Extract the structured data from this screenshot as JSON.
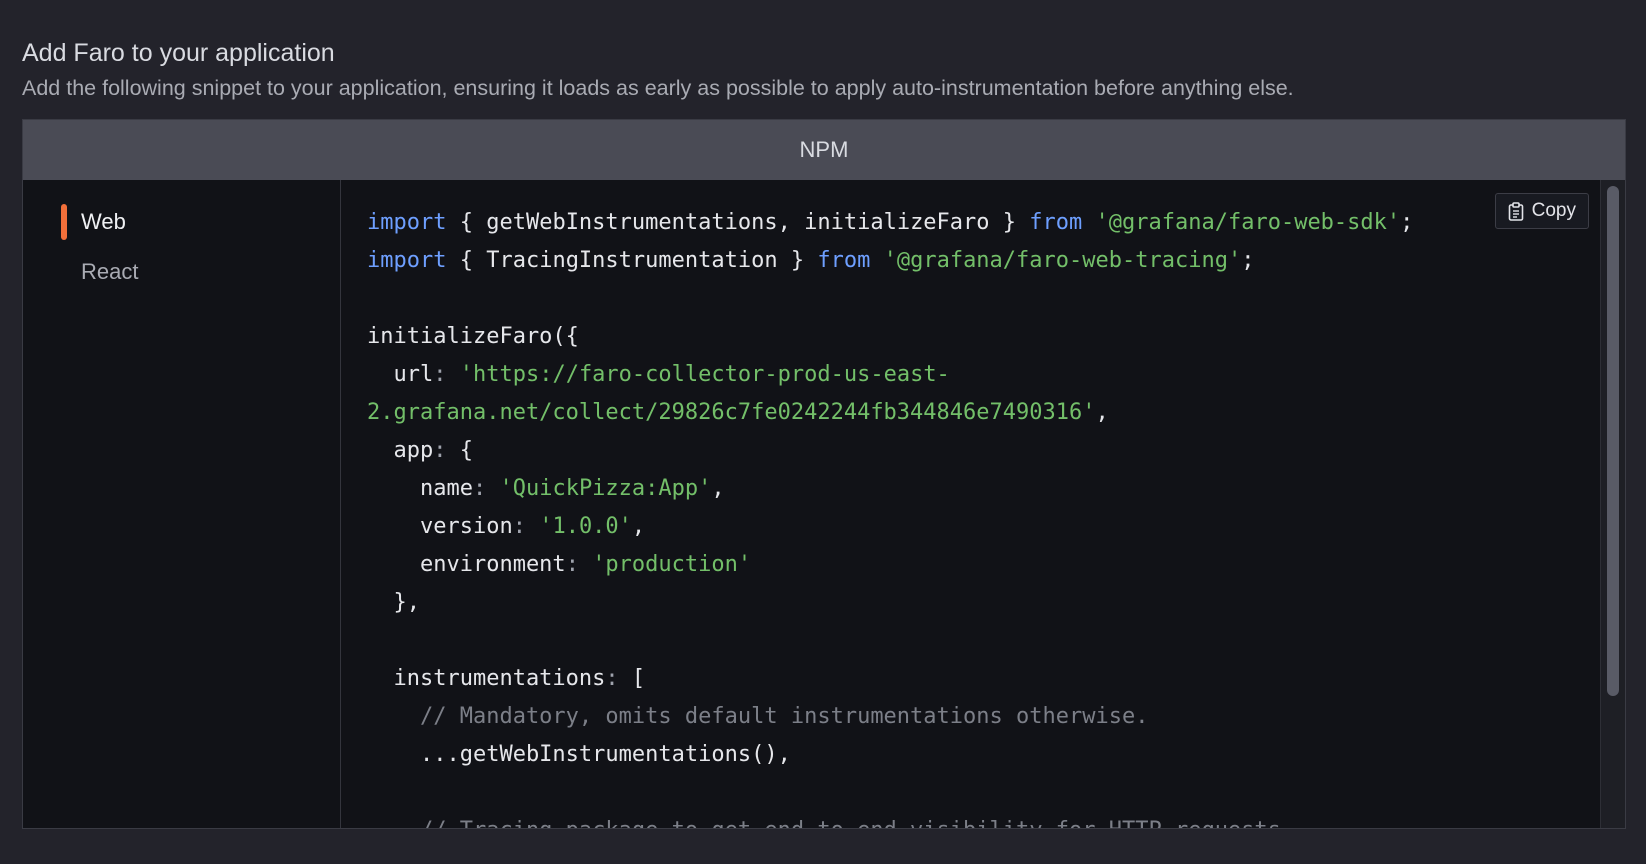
{
  "header": {
    "title": "Add Faro to your application",
    "description": "Add the following snippet to your application, ensuring it loads as early as possible to apply auto-instrumentation before anything else."
  },
  "tabs": [
    {
      "label": "NPM",
      "active": true
    }
  ],
  "sidebar": {
    "items": [
      {
        "label": "Web",
        "active": true
      },
      {
        "label": "React",
        "active": false
      }
    ]
  },
  "copy_button": {
    "label": "Copy",
    "icon": "clipboard-icon"
  },
  "code": {
    "line1": {
      "kw": "import",
      "mid": " { getWebInstrumentations, initializeFaro } ",
      "kw2": "from",
      "str": "'@grafana/faro-web-sdk'",
      "end": ";"
    },
    "line2": {
      "kw": "import",
      "mid": " { TracingInstrumentation } ",
      "kw2": "from",
      "str": "'@grafana/faro-web-tracing'",
      "end": ";"
    },
    "line4": "initializeFaro({",
    "url_key": "  url",
    "url_value_part1": "'https://faro-collector-prod-us-east-",
    "url_value_part2": "2.grafana.net/collect/29826c7fe0242244fb344846e7490316'",
    "app_key": "  app",
    "app_open": " {",
    "name_key": "    name",
    "name_value": "'QuickPizza:App'",
    "version_key": "    version",
    "version_value": "'1.0.0'",
    "env_key": "    environment",
    "env_value": "'production'",
    "app_close": "  },",
    "instr_key": "  instrumentations",
    "instr_open": " [",
    "comment1": "    // Mandatory, omits default instrumentations otherwise.",
    "spread": "    ...getWebInstrumentations(),",
    "comment2": "    // Tracing package to get end-to-end visibility for HTTP requests."
  },
  "colors": {
    "keyword": "#6e9fff",
    "string": "#73bf69",
    "comment": "#7c7f88",
    "accent": "#f26f3a"
  }
}
